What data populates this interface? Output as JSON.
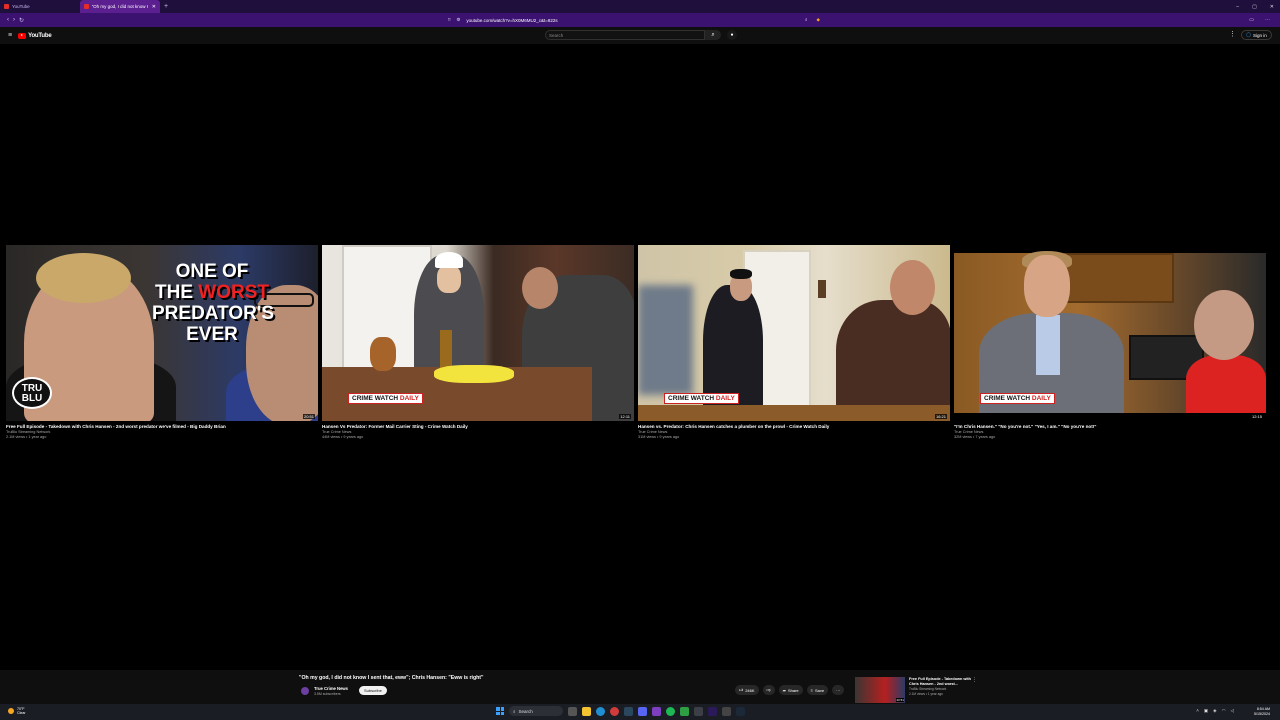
{
  "browser": {
    "tabs": [
      {
        "label": "YouTube",
        "active": false
      },
      {
        "label": "\"Oh my god, I did not know I se",
        "active": true
      }
    ],
    "new_tab": "+",
    "url": "youtube.com/watch?v=hX0M6MU2_c&t=822s",
    "window_controls": [
      "–",
      "▢",
      "✕"
    ]
  },
  "youtube": {
    "logo_text": "YouTube",
    "search_placeholder": "Search",
    "sign_in": "Sign in"
  },
  "end_screen": [
    {
      "title": "Free Full Episode - Takedown with Chris Hansen - 2nd worst predator we've filmed - Big Daddy Brian",
      "channel": "TruBlu Streaming Network",
      "meta": "2.1M views • 1 year ago",
      "duration": "20:51"
    },
    {
      "title": "Hansen Vs Predator: Former Mail Carrier Sting - Crime Watch Daily",
      "channel": "True Crime News",
      "meta": "44M views • 9 years ago",
      "duration": "12:11"
    },
    {
      "title": "Hansen vs. Predator: Chris Hansen catches a plumber on the prowl - Crime Watch Daily",
      "channel": "True Crime News",
      "meta": "31M views • 9 years ago",
      "duration": "16:21"
    },
    {
      "title": "\"I'm Chris Hansen.\" \"No you're not.\" \"Yes, I am.\" \"No you're not!\"",
      "channel": "True Crime News",
      "meta": "32M views • 7 years ago",
      "duration": "12:15"
    }
  ],
  "thumb_text": {
    "t1_line1": "ONE OF",
    "t1_line2a": "THE ",
    "t1_line2b": "WORST",
    "t1_line3": "PREDATOR'S",
    "t1_line4": "EVER",
    "t1_logo": "TRU BLU",
    "crime_watch_a": "CRIME WATCH",
    "crime_watch_b": "DAILY"
  },
  "video": {
    "title": "\"Oh my god, I did not know I sent that, eww\"; Chris Hansen: \"Eww is right\"",
    "channel": "True Crime News",
    "subscribers": "3.5M subscribers",
    "subscribe": "Subscribe",
    "likes": "246K",
    "share": "Share",
    "save": "Save",
    "more": "···"
  },
  "suggestion": {
    "title": "Free Full Episode - Takedown with Chris Hansen - 2nd worst...",
    "channel": "TruBlu Streaming Network",
    "meta": "2.1M views • 1 year ago",
    "duration": "20:51"
  },
  "taskbar": {
    "temp": "70°F",
    "cond": "Clear",
    "search": "Search",
    "time": "8:54 AM",
    "date": "5/15/2024"
  }
}
